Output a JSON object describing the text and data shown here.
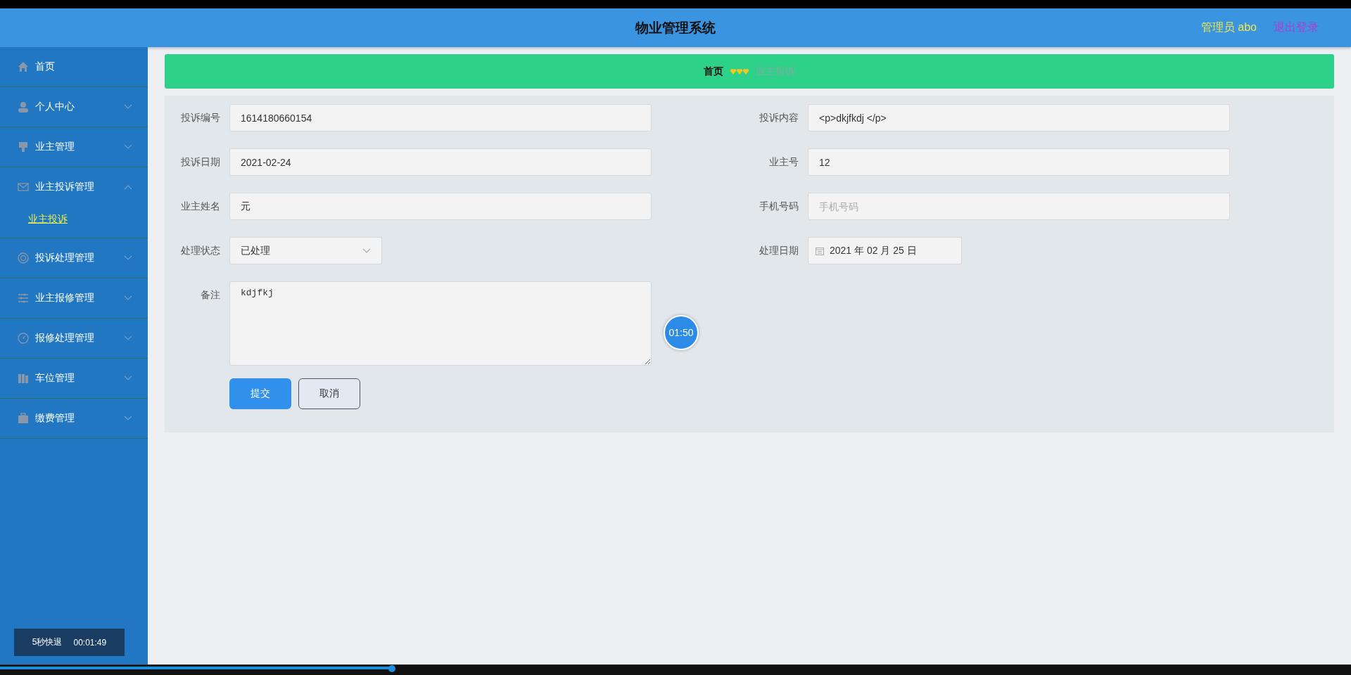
{
  "header": {
    "title": "物业管理系统",
    "user": "管理员 abo",
    "logout": "退出登录"
  },
  "sidebar": {
    "items": [
      {
        "label": "首页"
      },
      {
        "label": "个人中心",
        "expanded": false
      },
      {
        "label": "业主管理",
        "expanded": false
      },
      {
        "label": "业主投诉管理",
        "expanded": true,
        "children": [
          {
            "label": "业主投诉",
            "selected": true
          }
        ]
      },
      {
        "label": "投诉处理管理",
        "expanded": false
      },
      {
        "label": "业主报修管理",
        "expanded": false
      },
      {
        "label": "报修处理管理",
        "expanded": false
      },
      {
        "label": "车位管理",
        "expanded": false
      },
      {
        "label": "缴费管理",
        "expanded": false
      }
    ]
  },
  "breadcrumb": {
    "home": "首页",
    "current": "业主投诉"
  },
  "form": {
    "rows": [
      [
        {
          "label": "投诉编号",
          "kind": "text",
          "value": "1614180660154"
        },
        {
          "label": "投诉内容",
          "kind": "text",
          "value": "<p>dkjfkdj </p>"
        }
      ],
      [
        {
          "label": "投诉日期",
          "kind": "text",
          "value": "2021-02-24"
        },
        {
          "label": "业主号",
          "kind": "text",
          "value": "12"
        }
      ],
      [
        {
          "label": "业主姓名",
          "kind": "text",
          "value": "元"
        },
        {
          "label": "手机号码",
          "kind": "text",
          "placeholder": "手机号码"
        }
      ],
      [
        {
          "label": "处理状态",
          "kind": "select",
          "value": "已处理"
        },
        {
          "label": "处理日期",
          "kind": "date",
          "value": "2021 年 02 月 25 日"
        }
      ],
      [
        {
          "label": "备注",
          "kind": "textarea",
          "value": "kdjfkj"
        }
      ]
    ],
    "buttons": [
      {
        "label": "提交",
        "kind": "primary"
      },
      {
        "label": "取消",
        "kind": "plain"
      }
    ]
  },
  "timer_badge": "01:50",
  "player": {
    "rewind": "5秒快退",
    "time": "00:01:49",
    "progress": {
      "level": 0.29
    }
  }
}
